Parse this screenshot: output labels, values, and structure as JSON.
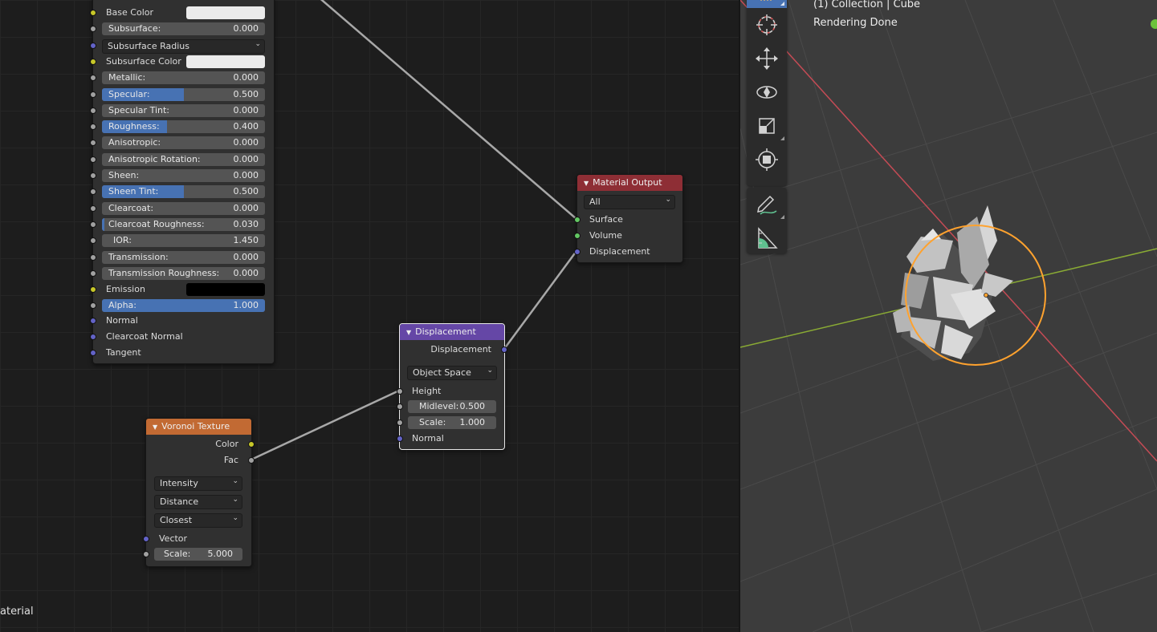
{
  "principled": {
    "rows": [
      {
        "label": "Base Color",
        "kind": "color",
        "socket": "yellow",
        "swatch": "#ebebeb"
      },
      {
        "label": "Subsurface:",
        "kind": "value",
        "value": "0.000",
        "fill": 0,
        "socket": "gray"
      },
      {
        "label": "Subsurface Radius",
        "kind": "dropdown",
        "socket": "blue"
      },
      {
        "label": "Subsurface Color",
        "kind": "color",
        "socket": "yellow",
        "swatch": "#ebebeb"
      },
      {
        "label": "Metallic:",
        "kind": "value",
        "value": "0.000",
        "fill": 0,
        "socket": "gray"
      },
      {
        "label": "Specular:",
        "kind": "value",
        "value": "0.500",
        "fill": 0.5,
        "socket": "gray"
      },
      {
        "label": "Specular Tint:",
        "kind": "value",
        "value": "0.000",
        "fill": 0,
        "socket": "gray"
      },
      {
        "label": "Roughness:",
        "kind": "value",
        "value": "0.400",
        "fill": 0.4,
        "socket": "gray"
      },
      {
        "label": "Anisotropic:",
        "kind": "value",
        "value": "0.000",
        "fill": 0,
        "socket": "gray"
      },
      {
        "label": "Anisotropic Rotation:",
        "kind": "value",
        "value": "0.000",
        "fill": 0,
        "socket": "gray"
      },
      {
        "label": "Sheen:",
        "kind": "value",
        "value": "0.000",
        "fill": 0,
        "socket": "gray"
      },
      {
        "label": "Sheen Tint:",
        "kind": "value",
        "value": "0.500",
        "fill": 0.5,
        "socket": "gray"
      },
      {
        "label": "Clearcoat:",
        "kind": "value",
        "value": "0.000",
        "fill": 0,
        "socket": "gray"
      },
      {
        "label": "Clearcoat Roughness:",
        "kind": "value",
        "value": "0.030",
        "fill": 0.03,
        "socket": "gray"
      },
      {
        "label": "IOR:",
        "kind": "value",
        "value": "1.450",
        "fill": 0,
        "socket": "gray"
      },
      {
        "label": "Transmission:",
        "kind": "value",
        "value": "0.000",
        "fill": 0,
        "socket": "gray"
      },
      {
        "label": "Transmission Roughness:",
        "kind": "value",
        "value": "0.000",
        "fill": 0,
        "socket": "gray"
      },
      {
        "label": "Emission",
        "kind": "color",
        "socket": "yellow",
        "swatch": "#000000"
      },
      {
        "label": "Alpha:",
        "kind": "value",
        "value": "1.000",
        "fill": 1,
        "socket": "gray"
      },
      {
        "label": "Normal",
        "kind": "plain",
        "socket": "blue"
      },
      {
        "label": "Clearcoat Normal",
        "kind": "plain",
        "socket": "blue"
      },
      {
        "label": "Tangent",
        "kind": "plain",
        "socket": "blue"
      }
    ]
  },
  "material_output": {
    "title": "Material Output",
    "target": "All",
    "inputs": [
      "Surface",
      "Volume",
      "Displacement"
    ]
  },
  "displacement": {
    "title": "Displacement",
    "output": "Displacement",
    "space": "Object Space",
    "height": "Height",
    "midlevel_label": "Midlevel:",
    "midlevel": "0.500",
    "scale_label": "Scale:",
    "scale": "1.000",
    "normal": "Normal"
  },
  "voronoi": {
    "title": "Voronoi Texture",
    "color_out": "Color",
    "fac_out": "Fac",
    "mode": "Intensity",
    "metric": "Distance",
    "feature": "Closest",
    "vector": "Vector",
    "scale_label": "Scale:",
    "scale": "5.000"
  },
  "editor": {
    "footer_label": "aterial"
  },
  "viewport": {
    "line1": "(1) Collection | Cube",
    "line2": "Rendering Done"
  },
  "toolbar": {
    "tools": [
      "select-box",
      "cursor",
      "move",
      "rotate",
      "scale",
      "transform"
    ],
    "tools2": [
      "annotate",
      "measure"
    ]
  },
  "colors": {
    "header_output": "#8e2e35",
    "header_vector": "#6547a6",
    "header_texture": "#c26a33",
    "selection": "#ffa22e",
    "axis_x": "#c44b55",
    "axis_y": "#8aab34",
    "field_fill": "#4772b3"
  }
}
